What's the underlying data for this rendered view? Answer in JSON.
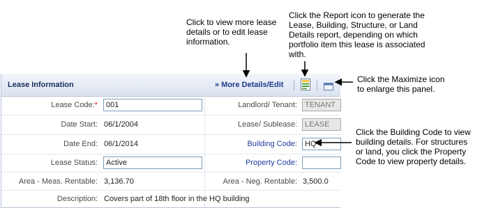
{
  "callouts": {
    "more_details": [
      "Click to view more lease",
      "details or to edit lease",
      "information."
    ],
    "report": [
      "Click the Report icon to generate the",
      "Lease, Building, Structure, or Land",
      "Details report, depending on which",
      "portfolio item this lease is associated",
      "with."
    ],
    "maximize": [
      "Click  the Maximize icon",
      "to enlarge this panel."
    ],
    "building_code": [
      "Click  the Building Code to view",
      "building details. For structures",
      "or land, you click the Property",
      "Code to view property details."
    ]
  },
  "panel": {
    "title": "Lease Information",
    "more_link": "» More Details/Edit",
    "report_icon": "report-icon",
    "maximize_icon": "maximize-icon"
  },
  "fields": {
    "lease_code": {
      "label": "Lease Code:",
      "required": "*",
      "value": "001"
    },
    "date_start": {
      "label": "Date Start:",
      "value": "06/1/2004"
    },
    "date_end": {
      "label": "Date End:",
      "value": "06/1/2014"
    },
    "lease_status": {
      "label": "Lease Status:",
      "value": "Active"
    },
    "area_meas": {
      "label": "Area - Meas. Rentable:",
      "value": "3,136.70"
    },
    "description": {
      "label": "Description:",
      "value": "Covers part of 18th floor in the HQ building"
    },
    "landlord_tenant": {
      "label": "Landlord/ Tenant:",
      "value": "TENANT"
    },
    "lease_sublease": {
      "label": "Lease/ Sublease:",
      "value": "LEASE"
    },
    "building_code": {
      "label": "Building Code:",
      "value": "HQ"
    },
    "property_code": {
      "label": "Property Code:",
      "value": ""
    },
    "area_neg": {
      "label": "Area - Neg. Rentable:",
      "value": "3,500.0"
    }
  },
  "colors": {
    "header_text": "#1c3160",
    "link": "#1c3b8c",
    "required": "#e02020"
  }
}
